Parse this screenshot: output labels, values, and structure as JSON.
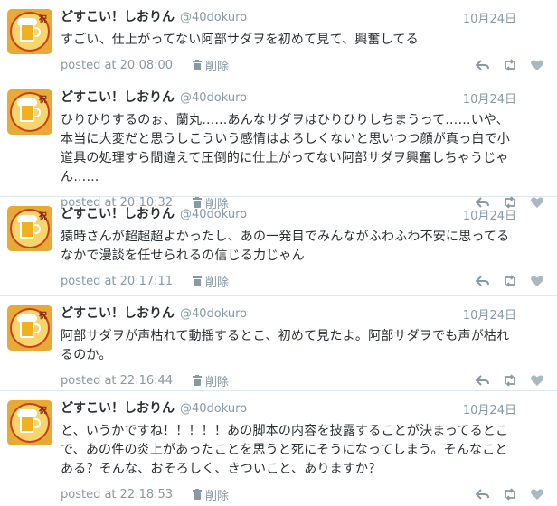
{
  "colors": {
    "text": "#292f33",
    "muted": "#8899a6",
    "border": "#e1e8ed"
  },
  "tweets": [
    {
      "fullname": "どすこい！しおりん",
      "screen_name": "@40dokuro",
      "date": "10月24日",
      "text": "すごい、仕上がってない阿部サダヲを初めて見て、興奮してる",
      "posted": "posted at 20:08:00",
      "delete_label": "削除"
    },
    {
      "fullname": "どすこい！しおりん",
      "screen_name": "@40dokuro",
      "date": "10月24日",
      "text": "ひりひりするのぉ、蘭丸……あんなサダヲはひりひりしちまうって……いや、本当に大変だと思うしこういう感情はよろしくないと思いつつ顔が真っ白で小道具の処理すら間違えて圧倒的に仕上がってない阿部サダヲ興奮しちゃうじゃん……",
      "posted": "posted at 20:10:32",
      "delete_label": "削除"
    },
    {
      "fullname": "どすこい！しおりん",
      "screen_name": "@40dokuro",
      "date": "10月24日",
      "text": "猿時さんが超超超よかったし、あの一発目でみんながふわふわ不安に思ってるなかで漫談を任せられるの信じる力じゃん",
      "posted": "posted at 20:17:11",
      "delete_label": "削除"
    },
    {
      "fullname": "どすこい！しおりん",
      "screen_name": "@40dokuro",
      "date": "10月24日",
      "text": "阿部サダヲが声枯れて動揺するとこ、初めて見たよ。阿部サダヲでも声が枯れるのか。",
      "posted": "posted at 22:16:44",
      "delete_label": "削除"
    },
    {
      "fullname": "どすこい！しおりん",
      "screen_name": "@40dokuro",
      "date": "10月24日",
      "text": "と、いうかですね！！！！！あの脚本の内容を披露することが決まってるとこで、あの件の炎上があったことを思うと死にそうになってしまう。そんなことある？そんな、おそろしく、きついこと、ありますか？",
      "posted": "posted at 22:18:53",
      "delete_label": "削除"
    }
  ]
}
